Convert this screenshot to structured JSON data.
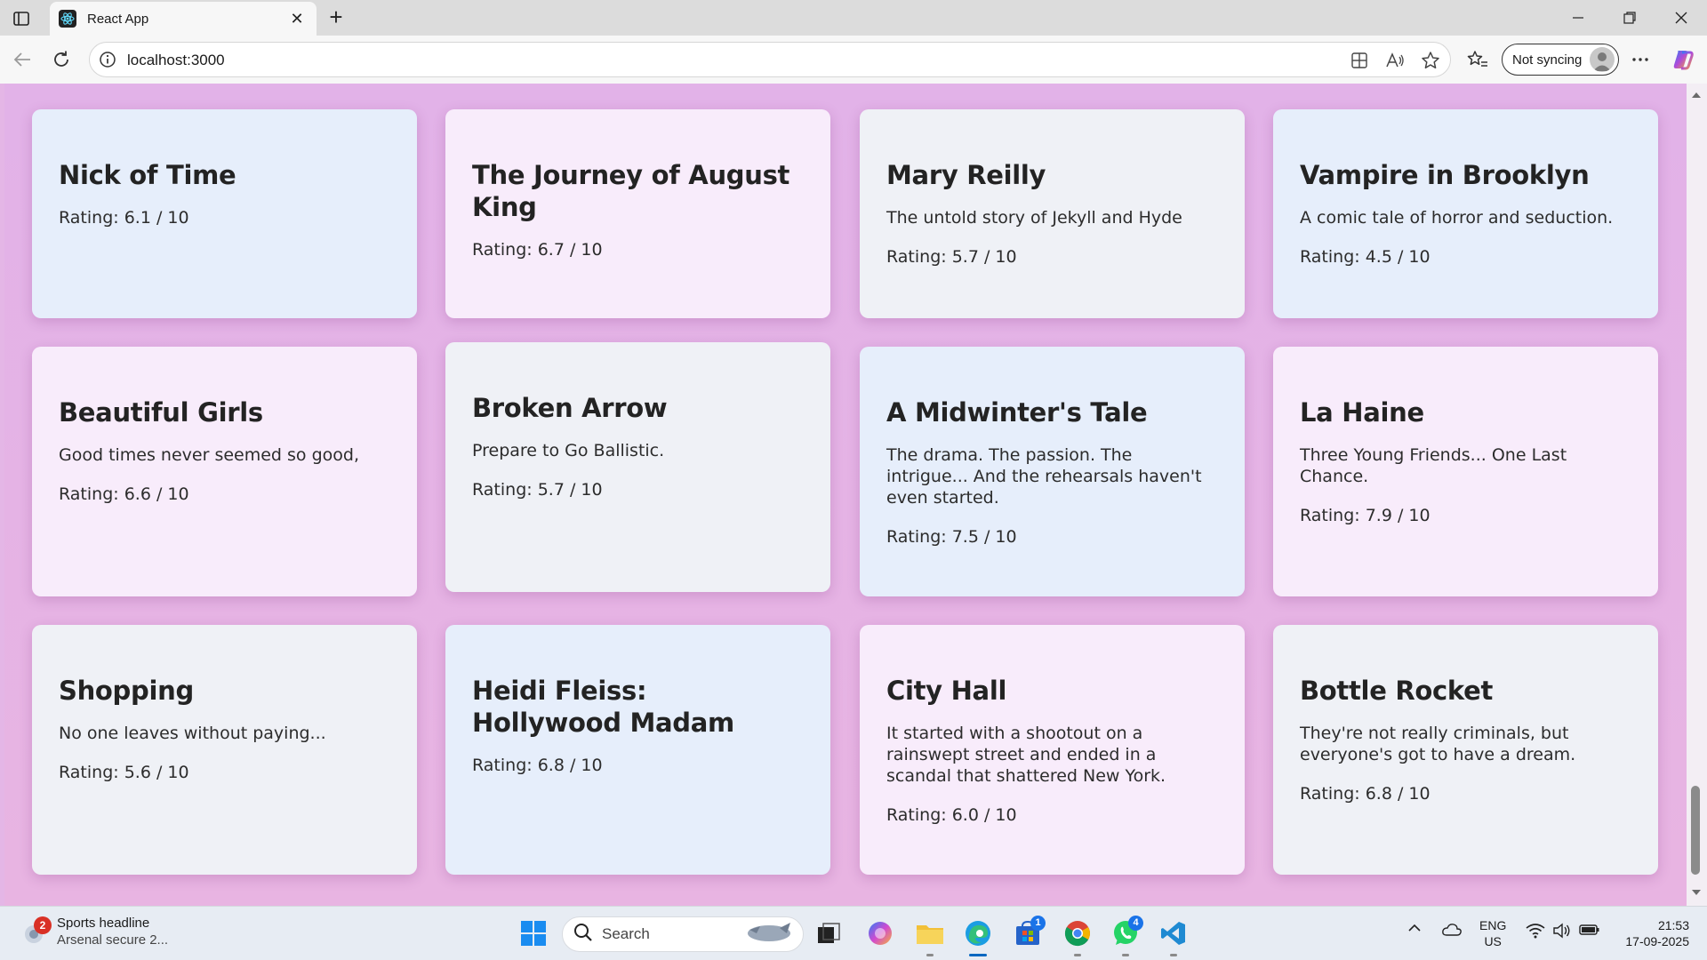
{
  "browser": {
    "tab_title": "React App",
    "url": "localhost:3000",
    "sync_label": "Not syncing"
  },
  "movies": [
    {
      "title": "Nick of Time",
      "tagline": "",
      "rating": "Rating: 6.1 / 10"
    },
    {
      "title": "The Journey of August King",
      "tagline": "",
      "rating": "Rating: 6.7 / 10"
    },
    {
      "title": "Mary Reilly",
      "tagline": "The untold story of Jekyll and Hyde",
      "rating": "Rating: 5.7 / 10"
    },
    {
      "title": "Vampire in Brooklyn",
      "tagline": "A comic tale of horror and seduction.",
      "rating": "Rating: 4.5 / 10"
    },
    {
      "title": "Beautiful Girls",
      "tagline": "Good times never seemed so good,",
      "rating": "Rating: 6.6 / 10"
    },
    {
      "title": "Broken Arrow",
      "tagline": "Prepare to Go Ballistic.",
      "rating": "Rating: 5.7 / 10"
    },
    {
      "title": "A Midwinter's Tale",
      "tagline": "The drama. The passion. The intrigue... And the rehearsals haven't even started.",
      "rating": "Rating: 7.5 / 10"
    },
    {
      "title": "La Haine",
      "tagline": "Three Young Friends... One Last Chance.",
      "rating": "Rating: 7.9 / 10"
    },
    {
      "title": "Shopping",
      "tagline": "No one leaves without paying...",
      "rating": "Rating: 5.6 / 10"
    },
    {
      "title": "Heidi Fleiss: Hollywood Madam",
      "tagline": "",
      "rating": "Rating: 6.8 / 10"
    },
    {
      "title": "City Hall",
      "tagline": "It started with a shootout on a rainswept street and ended in a scandal that shattered New York.",
      "rating": "Rating: 6.0 / 10"
    },
    {
      "title": "Bottle Rocket",
      "tagline": "They're not really criminals, but everyone's got to have a dream.",
      "rating": "Rating: 6.8 / 10"
    }
  ],
  "taskbar": {
    "news_badge": "2",
    "news_headline": "Sports headline",
    "news_sub": "Arsenal secure 2...",
    "search_label": "Search",
    "store_badge": "1",
    "whatsapp_badge": "4",
    "lang_top": "ENG",
    "lang_bottom": "US",
    "time": "21:53",
    "date": "17-09-2025"
  },
  "colors": {
    "page_background": "#e4b6e6",
    "card_blue": "#e6eefb",
    "card_pink": "#f8ecfb",
    "card_grey": "#eff1f6"
  }
}
